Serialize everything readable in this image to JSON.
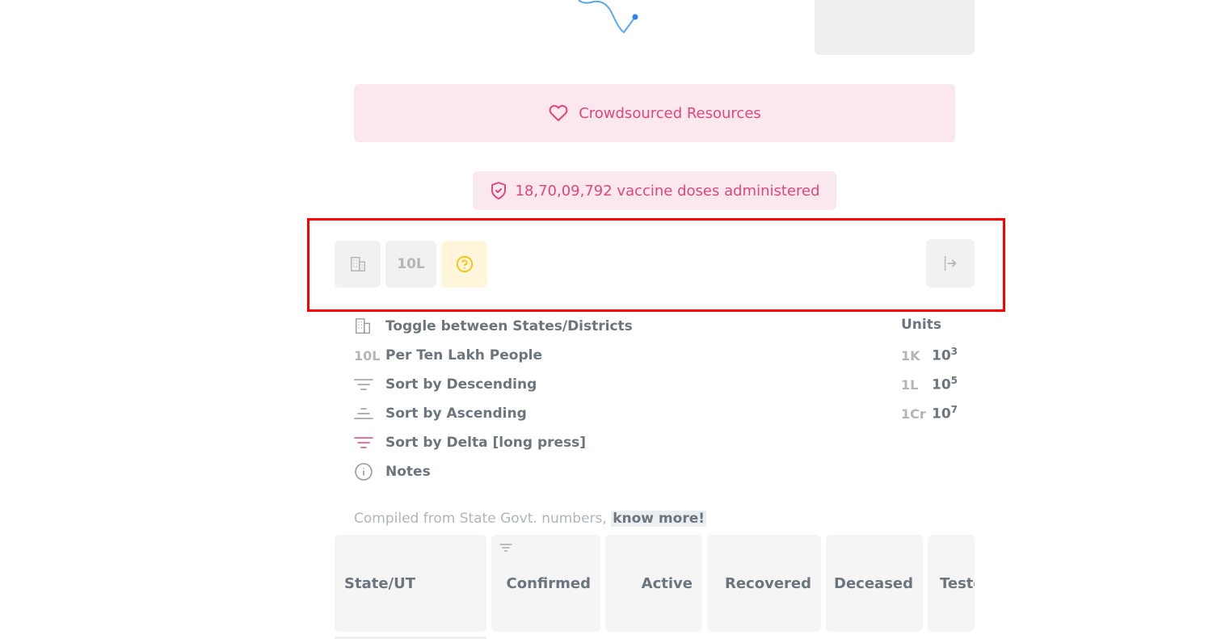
{
  "banner": {
    "resources_label": "Crowdsourced Resources"
  },
  "vaccine": {
    "text": "18,70,09,792 vaccine doses administered"
  },
  "toolbar": {
    "per_label": "10L"
  },
  "legend": {
    "items": [
      {
        "icon": "building-icon",
        "label": "Toggle between States/Districts"
      },
      {
        "icon_text": "10L",
        "label": "Per Ten Lakh People"
      },
      {
        "icon": "sort-descending-icon",
        "label": "Sort by Descending"
      },
      {
        "icon": "sort-ascending-icon",
        "label": "Sort by Ascending"
      },
      {
        "icon": "sort-delta-icon",
        "label": "Sort by Delta [long press]"
      },
      {
        "icon": "info-icon",
        "label": "Notes"
      }
    ],
    "units_title": "Units",
    "units": [
      {
        "abbr": "1K",
        "base": "10",
        "exp": "3"
      },
      {
        "abbr": "1L",
        "base": "10",
        "exp": "5"
      },
      {
        "abbr": "1Cr",
        "base": "10",
        "exp": "7"
      }
    ]
  },
  "compiled": {
    "text": "Compiled from State Govt. numbers, ",
    "link": "know more!"
  },
  "table": {
    "headers": [
      "State/UT",
      "Confirmed",
      "Active",
      "Recovered",
      "Deceased",
      "Tested"
    ]
  },
  "colors": {
    "accent_pink": "#e0467d",
    "spark_blue": "#2f80ed",
    "help_yellow": "#ffc107"
  }
}
